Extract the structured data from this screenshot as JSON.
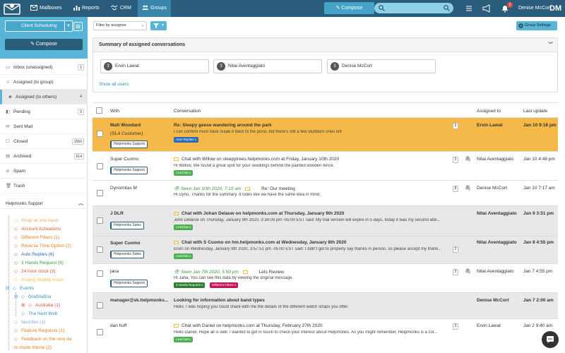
{
  "topbar": {
    "nav": [
      {
        "label": "Mailboxes",
        "icon": "mailbox-icon"
      },
      {
        "label": "Reports",
        "icon": "bar-chart-icon"
      },
      {
        "label": "CRM",
        "icon": "handshake-icon"
      },
      {
        "label": "Groups",
        "icon": "groups-icon",
        "active": true
      }
    ],
    "compose_label": "Compose",
    "search_placeholder": "",
    "notification_count": "2",
    "user_name": "Denise McCort",
    "user_initials": "DM"
  },
  "sidebar": {
    "mailbox_select": "Client Scheduling",
    "compose_label": "Compose",
    "folders": [
      {
        "label": "Inbox (unassigned)",
        "count": "1",
        "icon": "inbox-icon"
      },
      {
        "label": "Assigned (to group)",
        "count": "",
        "icon": "user-icon"
      },
      {
        "label": "Assigned (to others)",
        "count": "4",
        "icon": "users-icon",
        "active": true
      },
      {
        "label": "Pending",
        "count": "9",
        "icon": "pending-icon"
      },
      {
        "label": "Sent Mail",
        "count": "",
        "icon": "sent-icon"
      },
      {
        "label": "Closed",
        "count": "1550",
        "icon": "closed-icon"
      },
      {
        "label": "Archived",
        "count": "614",
        "icon": "archive-icon"
      },
      {
        "label": "Spam",
        "count": "",
        "icon": "spam-icon"
      },
      {
        "label": "Trash",
        "count": "",
        "icon": "trash-icon"
      }
    ],
    "section_label": "Helpmonks Support",
    "tags": [
      {
        "label": "Strap w/ one hand",
        "color": "#f4a460"
      },
      {
        "label": "Account Activations",
        "color": "#e05a2a"
      },
      {
        "label": "Different Fibers (1)",
        "color": "#e67e22"
      },
      {
        "label": "Reverse Time Option (2)",
        "color": "#e67e22"
      },
      {
        "label": "Auto Replies (6)",
        "color": "#2a6bb5"
      },
      {
        "label": "3 Hands Request (6)",
        "color": "#3a9a3a"
      },
      {
        "label": "24 hour clock (2)",
        "color": "#e74c3c"
      },
      {
        "label": "Analog display issue",
        "color": "#f0c040"
      },
      {
        "label": "Events",
        "color": "#3a8fd0"
      },
      {
        "label": "блаблабла",
        "color": "#3a8fd0"
      },
      {
        "label": "Australia (1)",
        "color": "#e74c3c"
      },
      {
        "label": "The Next Web",
        "color": "#3a8fd0"
      },
      {
        "label": "favorites (1)",
        "color": "#8aa8c8"
      },
      {
        "label": "Feature Requests (1)",
        "color": "#e67e22"
      },
      {
        "label": "Feedback on the new da",
        "color": "#e67e22"
      },
      {
        "label": "rk mode theme (2)",
        "color": "#e67e22"
      }
    ]
  },
  "toolbar": {
    "filter_label": "Filter by assignee",
    "group_settings_label": "Group Settings"
  },
  "summary": {
    "title": "Summary of assigned conversations",
    "agents": [
      {
        "count": "3",
        "name": "Ervin Lawat"
      },
      {
        "count": "3",
        "name": "Nitai Aventaggiato"
      },
      {
        "count": "3",
        "name": "Denise McCort"
      }
    ],
    "show_all": "Show all users"
  },
  "table": {
    "headers": {
      "with": "With",
      "conversation": "Conversation",
      "assigned": "Assigned to",
      "updated": "Last update"
    },
    "rows": [
      {
        "with": "Matt Woodard",
        "with2": "(SLA Customer)",
        "tag": "Helpmonks Support",
        "subject": "Re: Sleepy geese wandering around the park",
        "preview": "I can confirm most have made it back to the pond, but there's still a few stubborn ones left",
        "labels": [
          {
            "text": "Auto Replies",
            "color": "#2a6bb5"
          }
        ],
        "count": "6",
        "assigned": "Ervin Lawat",
        "updated": "Jan 10 9:18 pm"
      },
      {
        "with": "Super Cuomo",
        "tag": "Helpmonks Support",
        "subject": "Chat with Willow on sleepytrees.helpmonks.com at Friday, January 10th 2020",
        "preview": "Hi Willow, We found a great spot for your seedlings behind the painted wooden fence.",
        "labels": [
          {
            "text": "LiveChat",
            "color": "#4caf50"
          }
        ],
        "count": "2",
        "assigned": "Nitai Aventaggiato",
        "updated": "Jan 10 4:48 pm"
      },
      {
        "with": "Dynomitas M",
        "seen": "Seen Jan 10th 2020, 7:19 am",
        "subject": "Re: Our meeting",
        "preview": "Hi Dyno, Thanks for the summary. It looks like we have the same idea in mind.",
        "count": "8",
        "assigned": "Denise McCort",
        "updated": "Jan 10 7:17 am"
      },
      {
        "with": "J DLR",
        "tag": "Helpmonks Sales",
        "subject": "Chat with Johan Delauw on helpmonks.com at Thursday, January 9th 2020",
        "preview": "John Delarue on Thursday, January 9th 2020, 3:36:09 pm -05:00 EST said: My trial version will expire in 5 days, today it was my second atte...",
        "labels": [
          {
            "text": "LiveChat",
            "color": "#4caf50"
          }
        ],
        "assigned": "Nitai Aventaggiato",
        "updated": "Jan 9 3:51 pm"
      },
      {
        "with": "Super Cuomo",
        "tag": "Helpmonks Sales",
        "subject": "Chat with S Cuomo on hm.helpmonks.com at Wednesday, January 8th 2020",
        "preview": "Ervin on Wednesday, January 8th 2020, 3:57:51 pm -05:00 EST said: I didn't get to properly say thanks in person, so please accept my thank...",
        "labels": [
          {
            "text": "LiveChat",
            "color": "#4caf50"
          }
        ],
        "count": "2",
        "assigned": "Nitai Aventaggiato",
        "updated": "Jan 8 4:55 pm"
      },
      {
        "with": "jana",
        "tag": "Helpmonks Support",
        "seen": "Seen Jan 7th 2020, 5:50 pm",
        "subject": "Lets Review",
        "preview": "Hi Jana, You can see this data by viewing the original message.",
        "labels": [
          {
            "text": "3 Hands Request",
            "color": "#2e7d32"
          },
          {
            "text": "Different Fibers",
            "color": "#c2185b"
          }
        ],
        "count": "2",
        "assigned": "Nitai Aventaggiato",
        "updated": "Jan 7 4:55 pm"
      },
      {
        "with": "manager@sk.helpmonks...",
        "subject": "Looking for information about band types",
        "preview": "Hello, I was hoping you could share with me the details of the different watch straps you offer.",
        "assigned": "Denise McCort",
        "updated": "Jan 7 2:00 am"
      },
      {
        "with": "dan hoff",
        "subject": "Chat with Daniel on helpmonks.com at Thursday, February 27th 2020",
        "preview": "Hello Daniel, Hope all is well. I wanted to get in touch to check your interest about Helpmonks. As you might remember, Helpmonks is a col...",
        "labels": [
          {
            "text": "LiveChat",
            "color": "#4caf50"
          }
        ],
        "count": "3",
        "assigned": "Ervin Lawat",
        "updated": "Jan 2 9:40 am"
      }
    ]
  },
  "colors": {
    "topbar": "#2a5d7c",
    "accent": "#57b5d8",
    "highlight_row": "#f5b94a",
    "unread_row": "#e8e8e8"
  }
}
